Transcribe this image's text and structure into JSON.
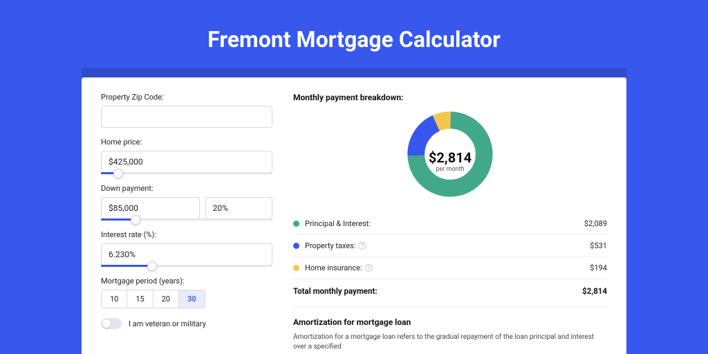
{
  "page": {
    "title": "Fremont Mortgage Calculator"
  },
  "form": {
    "zip": {
      "label": "Property Zip Code:",
      "value": ""
    },
    "home_price": {
      "label": "Home price:",
      "value": "$425,000",
      "slider_pct": 10
    },
    "down_payment": {
      "label": "Down payment:",
      "value": "$85,000",
      "pct_value": "20%",
      "slider_pct": 20
    },
    "interest": {
      "label": "Interest rate (%):",
      "value": "6.230%",
      "slider_pct": 30
    },
    "period": {
      "label": "Mortgage period (years):",
      "options": [
        "10",
        "15",
        "20",
        "30"
      ],
      "selected": "30"
    },
    "veteran": {
      "label": "I am veteran or military",
      "on": false
    }
  },
  "breakdown": {
    "title": "Monthly payment breakdown:",
    "center_amount": "$2,814",
    "center_sub": "per month",
    "rows": [
      {
        "label": "Principal & Interest:",
        "value": "$2,089",
        "color": "#41a988",
        "info": false
      },
      {
        "label": "Property taxes:",
        "value": "$531",
        "color": "#3757ed",
        "info": true
      },
      {
        "label": "Home insurance:",
        "value": "$194",
        "color": "#f3c74e",
        "info": true
      }
    ],
    "total": {
      "label": "Total monthly payment:",
      "value": "$2,814"
    }
  },
  "chart_data": {
    "type": "pie",
    "title": "Monthly payment breakdown",
    "series": [
      {
        "name": "Principal & Interest",
        "value": 2089,
        "color": "#41a988"
      },
      {
        "name": "Property taxes",
        "value": 531,
        "color": "#3757ed"
      },
      {
        "name": "Home insurance",
        "value": 194,
        "color": "#f3c74e"
      }
    ],
    "total": 2814
  },
  "amort": {
    "title": "Amortization for mortgage loan",
    "text": "Amortization for a mortgage loan refers to the gradual repayment of the loan principal and interest over a specified"
  }
}
